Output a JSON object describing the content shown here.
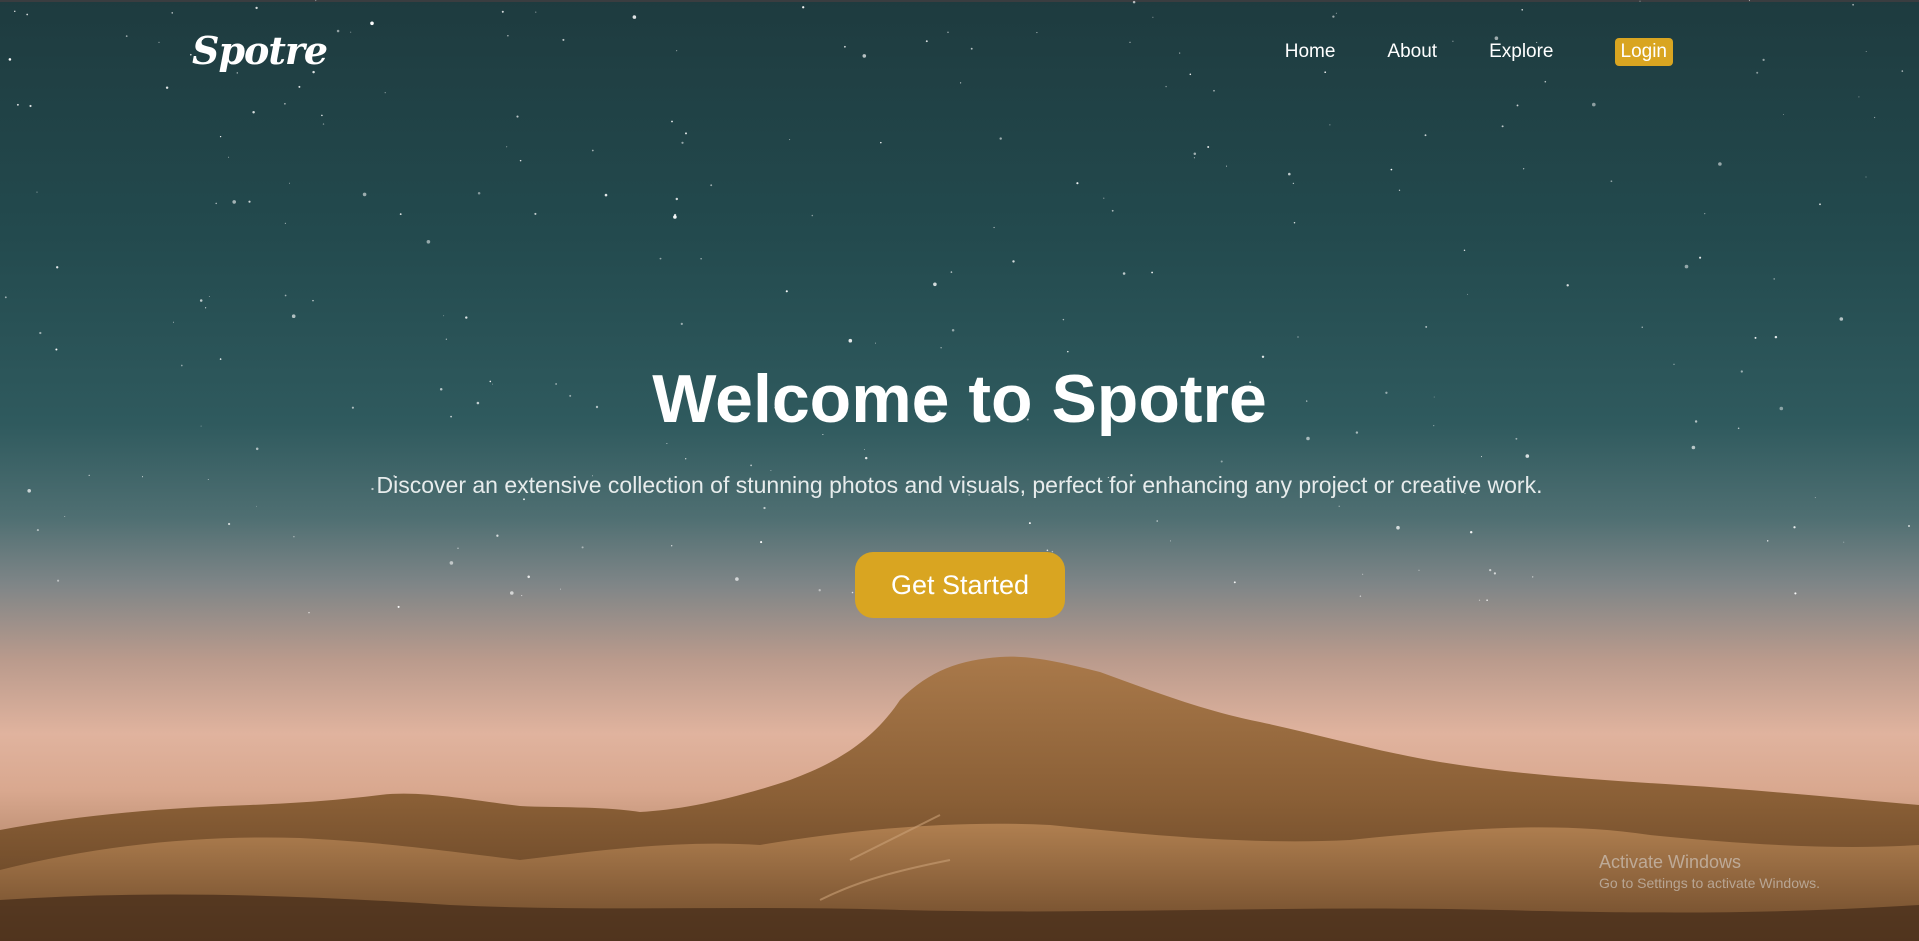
{
  "brand": {
    "logo_text": "Spotre",
    "accent_color": "#d9a521"
  },
  "nav": {
    "links": [
      {
        "label": "Home"
      },
      {
        "label": "About"
      },
      {
        "label": "Explore"
      }
    ],
    "login_label": "Login"
  },
  "hero": {
    "title": "Welcome to Spotre",
    "subtitle": "Discover an extensive collection of stunning photos and visuals, perfect for enhancing any project or creative work.",
    "cta_label": "Get Started",
    "background": "starry night sky over desert mountains"
  },
  "os_watermark": {
    "title": "Activate Windows",
    "subtitle": "Go to Settings to activate Windows."
  }
}
